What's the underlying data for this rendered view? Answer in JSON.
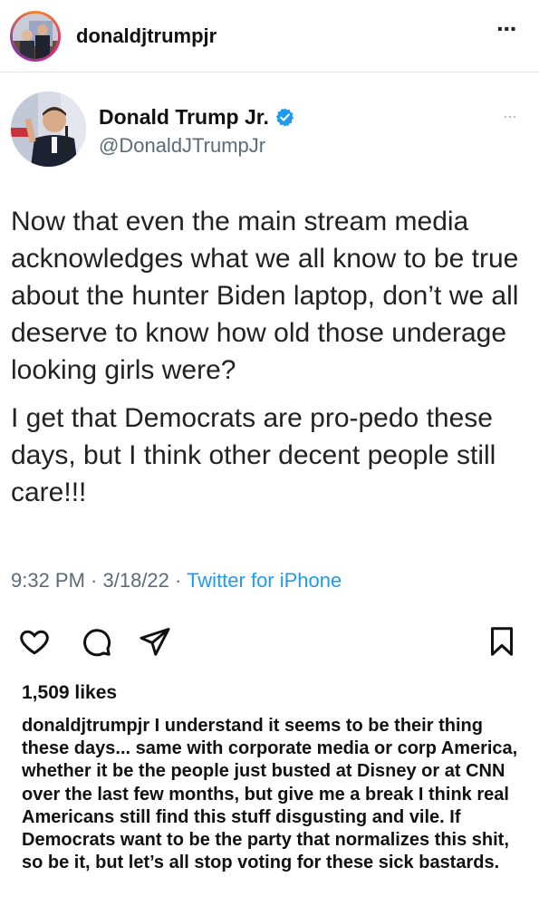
{
  "post": {
    "username": "donaldjtrumpjr",
    "more_icon": "more-horizontal-icon"
  },
  "tweet": {
    "display_name": "Donald Trump Jr.",
    "handle": "@DonaldJTrumpJr",
    "verified_color": "#1d9bf0",
    "more": "···",
    "paragraphs": [
      "Now that even the main stream media acknowledges what we all know to be true about the hunter Biden laptop, don’t we all deserve to know how old those underage looking girls were?",
      "I get that Democrats are pro-pedo these days, but I think other decent people still care!!!"
    ],
    "time": "9:32 PM",
    "date": "3/18/22",
    "source": "Twitter for iPhone",
    "separator": " · "
  },
  "actions": {
    "like_icon": "heart-icon",
    "comment_icon": "comment-icon",
    "share_icon": "send-icon",
    "save_icon": "bookmark-icon"
  },
  "likes": "1,509 likes",
  "caption": {
    "username": "donaldjtrumpjr",
    "text": " I understand it seems to be their thing these days... same with corporate media or corp America, whether it be the people just busted at Disney or at CNN over the last few months, but give me a break I think real Americans still find this stuff disgusting and vile. If Democrats want to be the party that normalizes this shit, so be it, but let’s all stop voting for these sick bastards."
  }
}
